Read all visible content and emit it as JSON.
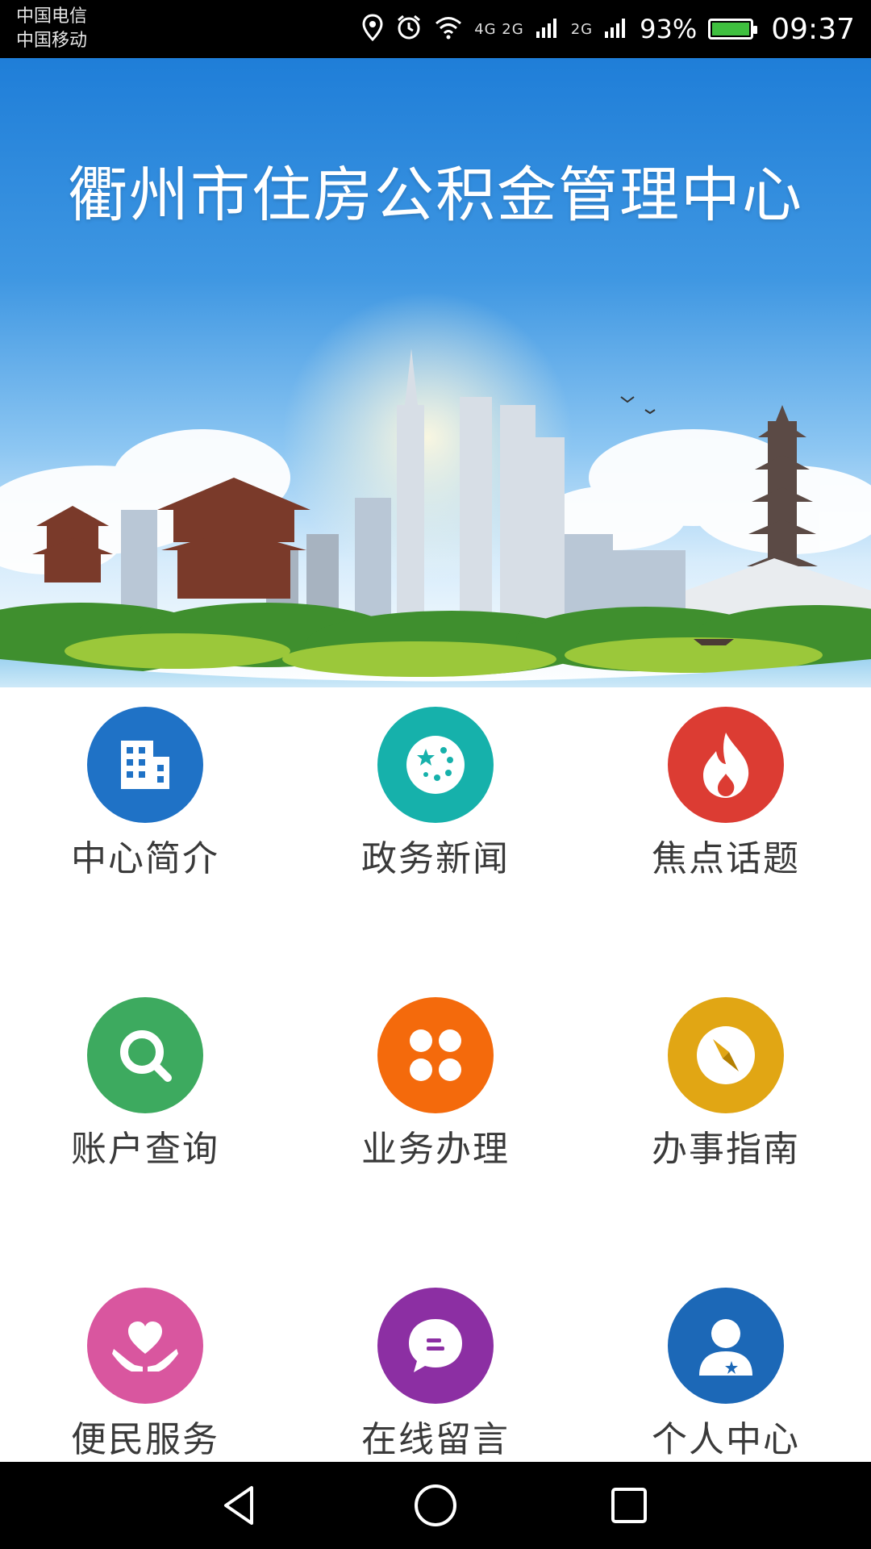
{
  "status_bar": {
    "carrier_1": "中国电信",
    "carrier_2": "中国移动",
    "net_1": "4G 2G",
    "net_2": "2G",
    "battery_percent": "93%",
    "time": "09:37",
    "icons": [
      "location-icon",
      "alarm-icon",
      "wifi-icon",
      "signal-icon",
      "signal-icon",
      "battery-icon"
    ]
  },
  "banner": {
    "title": "衢州市住房公积金管理中心"
  },
  "menu": {
    "items": [
      {
        "label": "中心简介",
        "icon": "building-icon",
        "color": "#1f72c6"
      },
      {
        "label": "政务新闻",
        "icon": "stars-icon",
        "color": "#16b1ab"
      },
      {
        "label": "焦点话题",
        "icon": "flame-icon",
        "color": "#dc3c33"
      },
      {
        "label": "账户查询",
        "icon": "search-icon",
        "color": "#3daa5f"
      },
      {
        "label": "业务办理",
        "icon": "clover-icon",
        "color": "#f46a0c"
      },
      {
        "label": "办事指南",
        "icon": "compass-icon",
        "color": "#e1a614"
      },
      {
        "label": "便民服务",
        "icon": "heart-hands-icon",
        "color": "#d9569f"
      },
      {
        "label": "在线留言",
        "icon": "chat-bubble-icon",
        "color": "#8c2fa3"
      },
      {
        "label": "个人中心",
        "icon": "user-icon",
        "color": "#1c68b7"
      }
    ]
  },
  "nav_bar": {
    "icons": [
      "back-icon",
      "home-icon",
      "recents-icon"
    ]
  }
}
